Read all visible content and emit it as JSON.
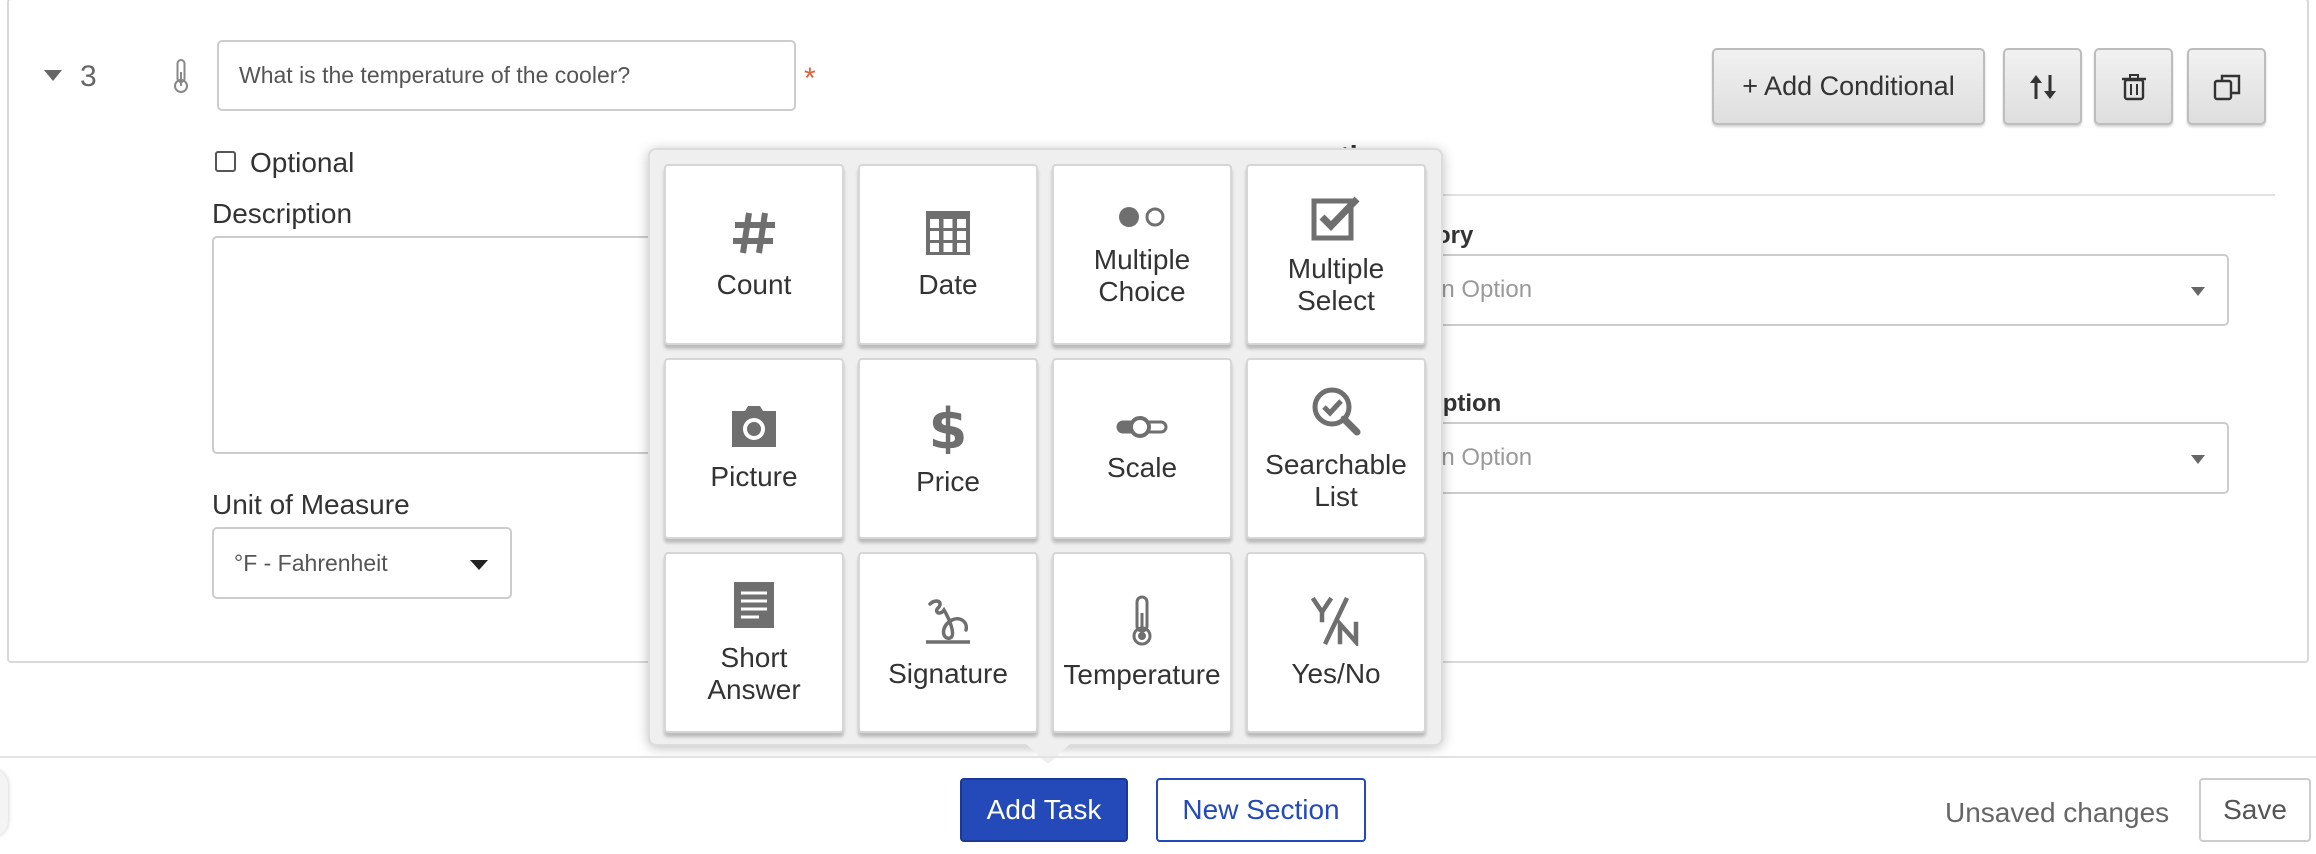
{
  "task": {
    "number": "3",
    "question_value": "What is the temperature of the cooler?",
    "required_mark": "*",
    "optional_label": "Optional",
    "description_label": "Description",
    "uom_label": "Unit of Measure",
    "uom_value": "°F - Fahrenheit",
    "add_conditional_label": "+ Add Conditional"
  },
  "properties": {
    "title": "ties",
    "category_label": "tegory",
    "category_placeholder": "an Option",
    "subscription_label": "scription",
    "subscription_placeholder": "an Option"
  },
  "task_types": [
    {
      "label": "Count",
      "icon": "hash-icon"
    },
    {
      "label": "Date",
      "icon": "calendar-grid-icon"
    },
    {
      "label": "Multiple Choice",
      "icon": "radio-dots-icon"
    },
    {
      "label": "Multiple Select",
      "icon": "checkbox-check-icon"
    },
    {
      "label": "Picture",
      "icon": "camera-icon"
    },
    {
      "label": "Price",
      "icon": "dollar-icon"
    },
    {
      "label": "Scale",
      "icon": "slider-icon"
    },
    {
      "label": "Searchable List",
      "icon": "search-check-icon"
    },
    {
      "label": "Short Answer",
      "icon": "document-lines-icon"
    },
    {
      "label": "Signature",
      "icon": "signature-icon"
    },
    {
      "label": "Temperature",
      "icon": "thermometer-icon"
    },
    {
      "label": "Yes/No",
      "icon": "yes-no-icon"
    }
  ],
  "footer": {
    "add_task": "Add Task",
    "new_section": "New Section",
    "status": "Unsaved changes",
    "save": "Save"
  },
  "colors": {
    "primary": "#2449b8",
    "required": "#e0603a",
    "icon": "#6f6f6f"
  }
}
